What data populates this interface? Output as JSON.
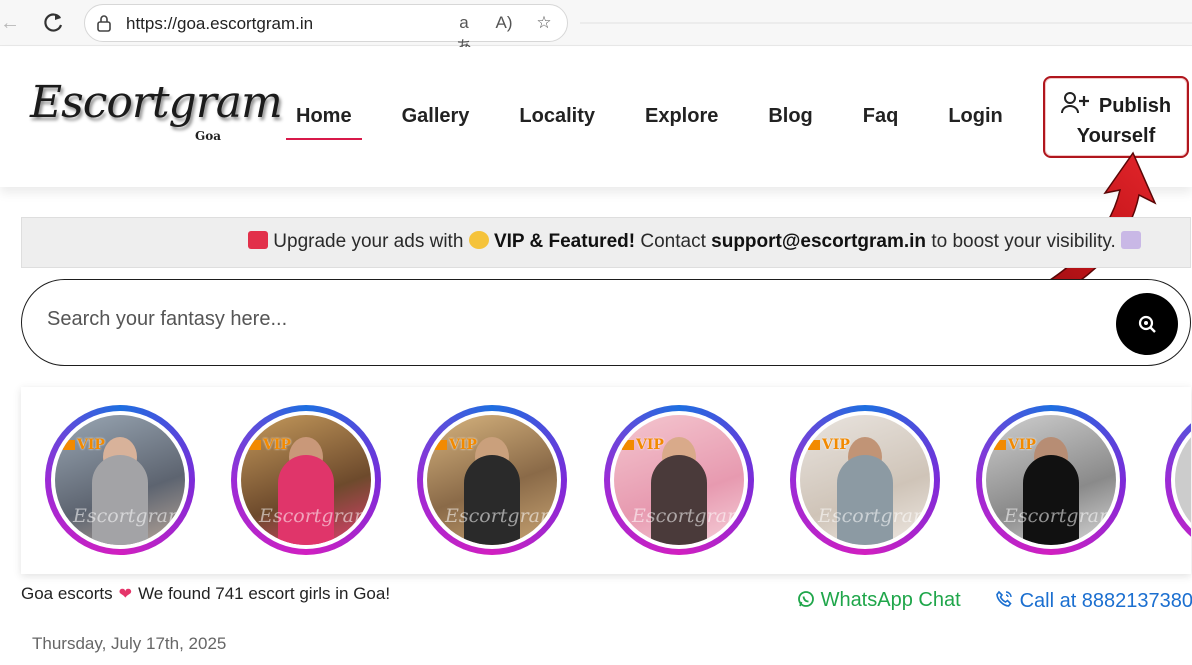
{
  "browser": {
    "url": "https://goa.escortgram.in",
    "icons": [
      "back-icon",
      "reload-icon",
      "lock-icon",
      "translate-icon",
      "read-aloud-icon",
      "favorite-star-icon"
    ]
  },
  "header": {
    "logo_text": "Escortgram",
    "logo_subtext": "Goa",
    "nav": [
      {
        "label": "Home",
        "active": true
      },
      {
        "label": "Gallery",
        "active": false
      },
      {
        "label": "Locality",
        "active": false
      },
      {
        "label": "Explore",
        "active": false
      },
      {
        "label": "Blog",
        "active": false
      },
      {
        "label": "Faq",
        "active": false
      },
      {
        "label": "Login",
        "active": false
      }
    ],
    "publish_line1": "Publish",
    "publish_line2": "Yourself"
  },
  "announcement": {
    "text_before": "Upgrade your ads with",
    "highlight": "VIP & Featured!",
    "text_middle": "Contact",
    "email": "support@escortgram.in",
    "text_after": "to boost your visibility."
  },
  "search": {
    "placeholder": "Search your fantasy here..."
  },
  "stories": {
    "badge": "VIP",
    "watermark": "Escortgram"
  },
  "info": {
    "found_prefix": "Goa escorts",
    "found_text": "We found 741 escort girls in Goa!",
    "whatsapp": "WhatsApp Chat",
    "call": "Call at 8882137380",
    "date": "Thursday, July 17th, 2025"
  },
  "colors": {
    "accent_pink": "#d8194a",
    "publish_border": "#b0161d",
    "whatsapp_green": "#1fa64a",
    "call_blue": "#1b6fd0",
    "vip_orange": "#f28a00"
  }
}
